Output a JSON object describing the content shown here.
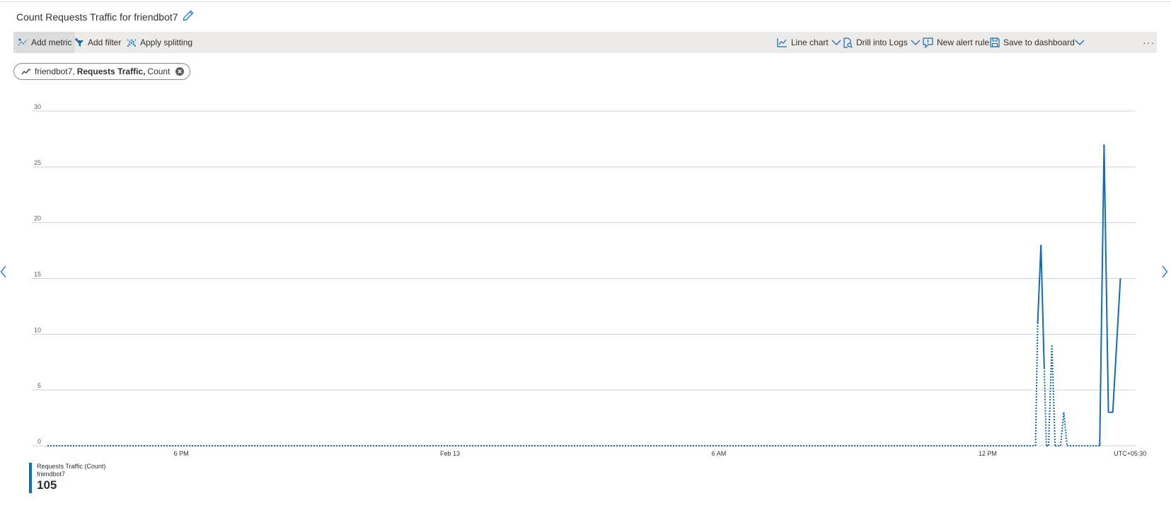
{
  "header": {
    "title": "Count Requests Traffic for friendbot7"
  },
  "toolbar": {
    "add_metric": "Add metric",
    "add_filter": "Add filter",
    "apply_splitting": "Apply splitting",
    "line_chart": "Line chart",
    "drill_into_logs": "Drill into Logs",
    "new_alert_rule": "New alert rule",
    "save_to_dashboard": "Save to dashboard",
    "more": "···"
  },
  "metric_pill": {
    "resource": "friendbot7,",
    "metric": "Requests Traffic,",
    "aggregation": "Count"
  },
  "legend": {
    "series_label": "Requests Traffic (Count)",
    "resource": "friendbot7",
    "value": "105"
  },
  "colors": {
    "series": "#0f6cbd",
    "toolbar_bg": "#edebe9",
    "gridline": "#d2d0ce"
  },
  "chart_data": {
    "type": "line",
    "y_ticks": [
      "30",
      "25",
      "20",
      "15",
      "10",
      "5",
      "0"
    ],
    "ylim": [
      0,
      30
    ],
    "x_ticks": [
      {
        "label": "6 PM",
        "t": 0.123
      },
      {
        "label": "Feb 13",
        "t": 0.37
      },
      {
        "label": "6 AM",
        "t": 0.617
      },
      {
        "label": "12 PM",
        "t": 0.864
      },
      {
        "label": "UTC+05:30",
        "t": 0.995
      }
    ],
    "timezone": "UTC+05:30",
    "grid": true,
    "series": [
      {
        "color": "#0f6cbd",
        "points": [
          {
            "t": 0.0,
            "y": 0
          },
          {
            "t": 0.908,
            "y": 0
          },
          {
            "t": 0.91,
            "y": 11
          },
          {
            "t": 0.913,
            "y": 18
          },
          {
            "t": 0.916,
            "y": 7
          },
          {
            "t": 0.918,
            "y": 0
          },
          {
            "t": 0.92,
            "y": 0
          },
          {
            "t": 0.923,
            "y": 9
          },
          {
            "t": 0.926,
            "y": 0
          },
          {
            "t": 0.931,
            "y": 0
          },
          {
            "t": 0.934,
            "y": 3
          },
          {
            "t": 0.937,
            "y": 0
          },
          {
            "t": 0.967,
            "y": 0
          },
          {
            "t": 0.971,
            "y": 27
          },
          {
            "t": 0.975,
            "y": 3
          },
          {
            "t": 0.979,
            "y": 3
          },
          {
            "t": 0.986,
            "y": 15
          }
        ],
        "solid_segments": [
          [
            2,
            4
          ],
          [
            12,
            16
          ]
        ]
      }
    ]
  }
}
